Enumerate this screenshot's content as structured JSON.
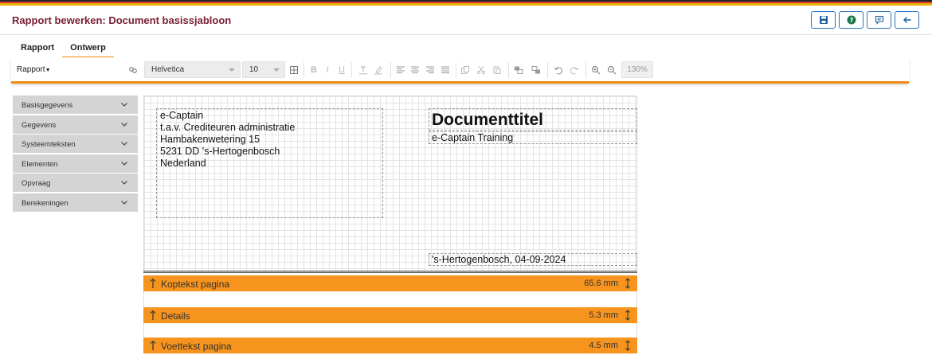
{
  "header": {
    "title": "Rapport bewerken: Document basissjabloon",
    "buttons": [
      {
        "name": "save-button",
        "icon": "floppy-disk-icon"
      },
      {
        "name": "help-button",
        "icon": "question-icon"
      },
      {
        "name": "comment-button",
        "icon": "comment-icon"
      },
      {
        "name": "back-button",
        "icon": "arrow-left-icon"
      }
    ]
  },
  "tabs": [
    {
      "label": "Rapport",
      "active": false
    },
    {
      "label": "Ontwerp",
      "active": true
    }
  ],
  "toolbar": {
    "rapport_label": "Rapport",
    "font": "Helvetica",
    "size": "10",
    "zoom": "130%"
  },
  "sidebar": {
    "items": [
      {
        "label": "Basisgegevens"
      },
      {
        "label": "Gegevens"
      },
      {
        "label": "Systeemteksten"
      },
      {
        "label": "Elementen"
      },
      {
        "label": "Opvraag"
      },
      {
        "label": "Berekeningen"
      }
    ]
  },
  "document": {
    "address": [
      "e-Captain",
      "t.a.v. Crediteuren administratie",
      "Hambakenwetering 15",
      "5231 DD 's-Hertogenbosch",
      "Nederland"
    ],
    "title": "Documenttitel",
    "subtitle": "e-Captain Training",
    "place_date": "'s-Hertogenbosch, 04-09-2024"
  },
  "bands": [
    {
      "label": "Koptekst pagina",
      "size": "65.6 mm"
    },
    {
      "label": "Details",
      "size": "5.3 mm"
    },
    {
      "label": "Voettekst pagina",
      "size": "4.5 mm"
    }
  ],
  "colors": {
    "accent": "#f08c14",
    "band": "#f7941d",
    "title": "#7a1e36",
    "button_border": "#2a72b8"
  }
}
